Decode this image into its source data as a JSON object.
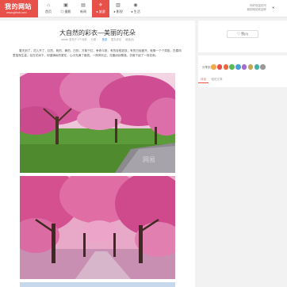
{
  "site": {
    "logo_title": "我的网站",
    "logo_sub": "www.github.com"
  },
  "nav": [
    {
      "label": "首页",
      "icon": "⌂"
    },
    {
      "label": "◎ 摄影",
      "icon": "▣"
    },
    {
      "label": "新闻",
      "icon": "▤"
    },
    {
      "label": "● 旅游",
      "icon": "✈"
    },
    {
      "label": "● 影视",
      "icon": "▥"
    },
    {
      "label": "● 生活",
      "icon": "◉"
    }
  ],
  "top_right": {
    "line1": "你好欢迎访问",
    "line2": "我的网站欢迎你",
    "button": "✕"
  },
  "article": {
    "title": "大自然的彩衣—美丽的花朵",
    "meta": {
      "author": "admin 发布于 2个月前",
      "category_prefix": "分类：",
      "category": "旅游",
      "comments": "暂无评论",
      "views": "阅读(9)"
    },
    "paragraph": "春天到了，花儿开了，红的、粉的、黄的、白的，万紫千红，争奇斗艳，有的含苞欲放，有的已经盛开，就像一个个笑脸，在春风里摇曳生姿。站在花树下，仰望满树的繁花，心中充满了喜悦。一阵风吹过，花瓣纷纷飘落，仿佛下起了一场花雨。",
    "watermark": "网易",
    "accent": "#e8504a"
  },
  "sidebar": {
    "like_label": "♡ 赞(0)",
    "share_label": "分享到：",
    "share_colors": [
      "#f1a94b",
      "#e8504a",
      "#e86a3a",
      "#5cb85c",
      "#49a0d8",
      "#a16bd0",
      "#c6a55a",
      "#44b3a5",
      "#999999"
    ],
    "tabs": [
      "评论",
      "相关文章"
    ]
  }
}
